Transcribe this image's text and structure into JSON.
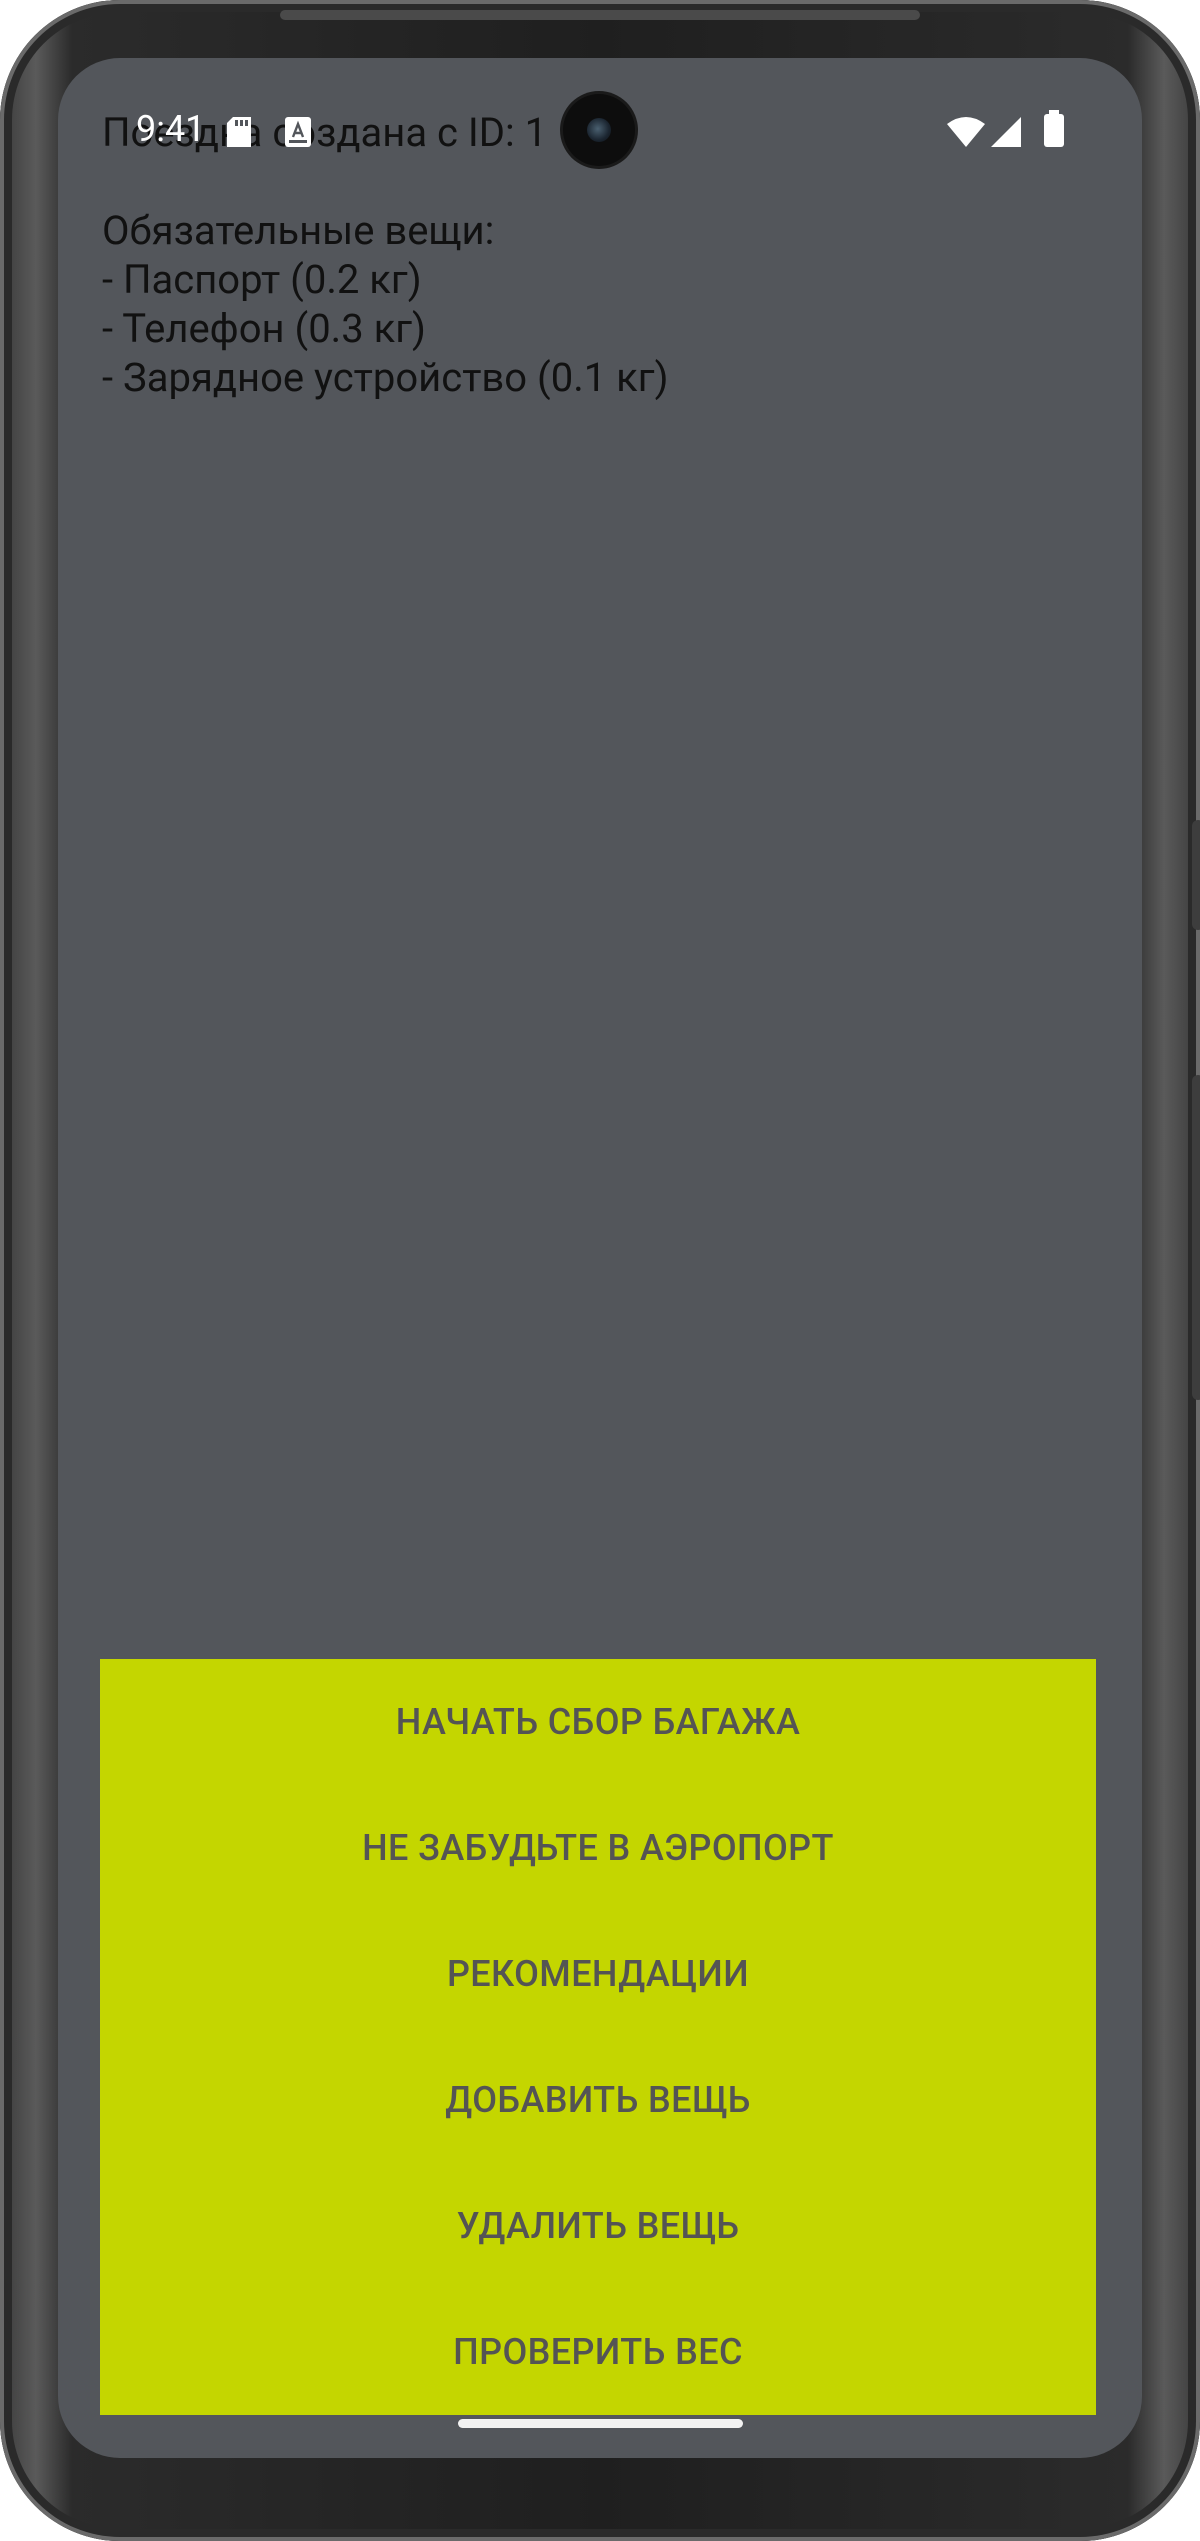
{
  "status_bar": {
    "time": "9:41",
    "icons_left": [
      "sd-card-icon",
      "keyboard-a-icon"
    ],
    "icons_right": [
      "wifi-icon",
      "cellular-signal-icon",
      "battery-icon"
    ]
  },
  "content": {
    "trip_line": "Поездка создана с ID: 1",
    "required_header": "Обязательные вещи:",
    "required_items": [
      "- Паспорт (0.2 кг)",
      "- Телефон (0.3 кг)",
      "- Зарядное устройство (0.1 кг)"
    ]
  },
  "actions": {
    "start_packing": "НАЧАТЬ СБОР БАГАЖА",
    "airport_reminder": "НЕ ЗАБУДЬТЕ В АЭРОПОРТ",
    "recommendations": "РЕКОМЕНДАЦИИ",
    "add_item": "ДОБАВИТЬ ВЕЩЬ",
    "remove_item": "УДАЛИТЬ ВЕЩЬ",
    "check_weight": "ПРОВЕРИТЬ ВЕС"
  },
  "colors": {
    "screen_background": "#53565b",
    "button_panel": "#c4d600",
    "button_text": "#545454"
  }
}
